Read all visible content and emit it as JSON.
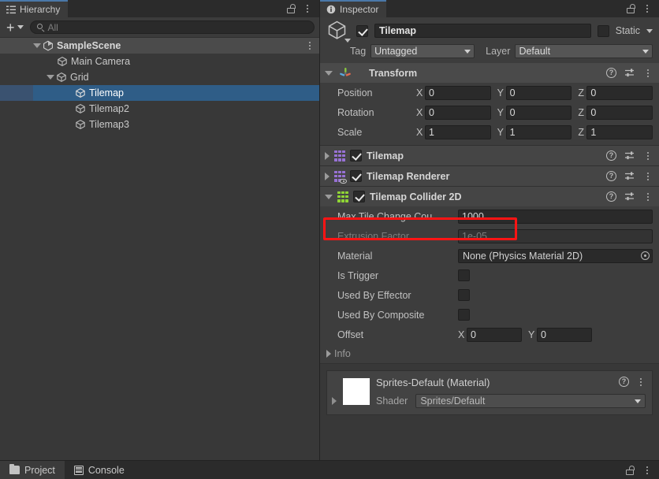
{
  "hierarchy": {
    "tab_label": "Hierarchy",
    "tab_icon": "hierarchy-icon",
    "lock_icon": "lock-open-icon",
    "menu_icon": "kebab-menu-icon",
    "toolbar": {
      "add_label": "+",
      "add_dropdown_icon": "chevron-down-icon",
      "search_icon": "search-icon",
      "search_placeholder": "All",
      "search_value": ""
    },
    "items": [
      {
        "label": "SampleScene",
        "icon": "unity-scene-icon",
        "depth": 0,
        "expanded": true,
        "selected": false,
        "is_scene": true,
        "menu_icon": "kebab-menu-icon"
      },
      {
        "label": "Main Camera",
        "icon": "gameobject-cube-icon",
        "depth": 1,
        "expanded": null,
        "selected": false,
        "is_scene": false
      },
      {
        "label": "Grid",
        "icon": "gameobject-cube-icon",
        "depth": 1,
        "expanded": true,
        "selected": false,
        "is_scene": false
      },
      {
        "label": "Tilemap",
        "icon": "gameobject-cube-icon",
        "depth": 2,
        "expanded": null,
        "selected": true,
        "is_scene": false
      },
      {
        "label": "Tilemap2",
        "icon": "gameobject-cube-icon",
        "depth": 2,
        "expanded": null,
        "selected": false,
        "is_scene": false
      },
      {
        "label": "Tilemap3",
        "icon": "gameobject-cube-icon",
        "depth": 2,
        "expanded": null,
        "selected": false,
        "is_scene": false
      }
    ]
  },
  "inspector": {
    "tab_label": "Inspector",
    "tab_icon": "info-icon",
    "lock_icon": "lock-open-icon",
    "menu_icon": "kebab-menu-icon",
    "object_header": {
      "icon": "gameobject-cube-icon",
      "enabled": true,
      "name_value": "Tilemap",
      "static_checked": false,
      "static_label": "Static",
      "static_dropdown_icon": "chevron-down-icon",
      "tag_label": "Tag",
      "tag_value": "Untagged",
      "layer_label": "Layer",
      "layer_value": "Default"
    },
    "components": [
      {
        "id": "transform",
        "title": "Transform",
        "icon": "transform-axis-icon",
        "expanded": true,
        "has_enable_checkbox": false,
        "help_icon": "help-icon",
        "preset_icon": "preset-sliders-icon",
        "menu_icon": "kebab-menu-icon",
        "rows": [
          {
            "label": "Position",
            "type": "vector3",
            "axes": [
              "X",
              "Y",
              "Z"
            ],
            "values": [
              "0",
              "0",
              "0"
            ]
          },
          {
            "label": "Rotation",
            "type": "vector3",
            "axes": [
              "X",
              "Y",
              "Z"
            ],
            "values": [
              "0",
              "0",
              "0"
            ]
          },
          {
            "label": "Scale",
            "type": "vector3",
            "axes": [
              "X",
              "Y",
              "Z"
            ],
            "values": [
              "1",
              "1",
              "1"
            ]
          }
        ]
      },
      {
        "id": "tilemap",
        "title": "Tilemap",
        "icon": "tilemap-grid-icon",
        "icon_color": "#9872d6",
        "expanded": false,
        "has_enable_checkbox": true,
        "enabled": true,
        "help_icon": "help-icon",
        "preset_icon": "preset-sliders-icon",
        "menu_icon": "kebab-menu-icon",
        "rows": []
      },
      {
        "id": "tilemap-renderer",
        "title": "Tilemap Renderer",
        "icon": "tilemap-renderer-icon",
        "icon_color": "#9872d6",
        "expanded": false,
        "has_enable_checkbox": true,
        "enabled": true,
        "help_icon": "help-icon",
        "preset_icon": "preset-sliders-icon",
        "menu_icon": "kebab-menu-icon",
        "rows": []
      },
      {
        "id": "tilemap-collider-2d",
        "title": "Tilemap Collider 2D",
        "icon": "tilemap-collider-icon",
        "icon_color": "#8fd435",
        "expanded": true,
        "highlighted": true,
        "has_enable_checkbox": true,
        "enabled": true,
        "help_icon": "help-icon",
        "preset_icon": "preset-sliders-icon",
        "menu_icon": "kebab-menu-icon",
        "rows": [
          {
            "label": "Max Tile Change Cou",
            "type": "text",
            "value": "1000",
            "disabled": false
          },
          {
            "label": "Extrusion Factor",
            "type": "text",
            "value": "1e-05",
            "disabled": true
          },
          {
            "label": "Material",
            "type": "object",
            "value": "None (Physics Material 2D)",
            "picker_icon": "object-picker-icon"
          },
          {
            "label": "Is Trigger",
            "type": "checkbox",
            "checked": false
          },
          {
            "label": "Used By Effector",
            "type": "checkbox",
            "checked": false
          },
          {
            "label": "Used By Composite",
            "type": "checkbox",
            "checked": false
          },
          {
            "label": "Offset",
            "type": "vector2",
            "axes": [
              "X",
              "Y"
            ],
            "values": [
              "0",
              "0"
            ]
          }
        ],
        "foldout": {
          "label": "Info",
          "expanded": false,
          "icon": "chevron-right-icon"
        }
      }
    ],
    "material_preview": {
      "swatch_color": "#ffffff",
      "title": "Sprites-Default (Material)",
      "shader_label": "Shader",
      "shader_value": "Sprites/Default",
      "shader_dropdown_icon": "chevron-down-icon",
      "help_icon": "help-icon",
      "menu_icon": "kebab-menu-icon",
      "expand_icon": "chevron-right-icon"
    }
  },
  "bottom_bar": {
    "tabs": [
      {
        "label": "Project",
        "icon": "folder-icon",
        "active": true
      },
      {
        "label": "Console",
        "icon": "console-icon",
        "active": false
      }
    ],
    "lock_icon": "lock-open-icon",
    "menu_icon": "kebab-menu-icon"
  },
  "annotation": {
    "type": "highlight-box",
    "color": "#ff1414",
    "target": "Tilemap Collider 2D"
  }
}
